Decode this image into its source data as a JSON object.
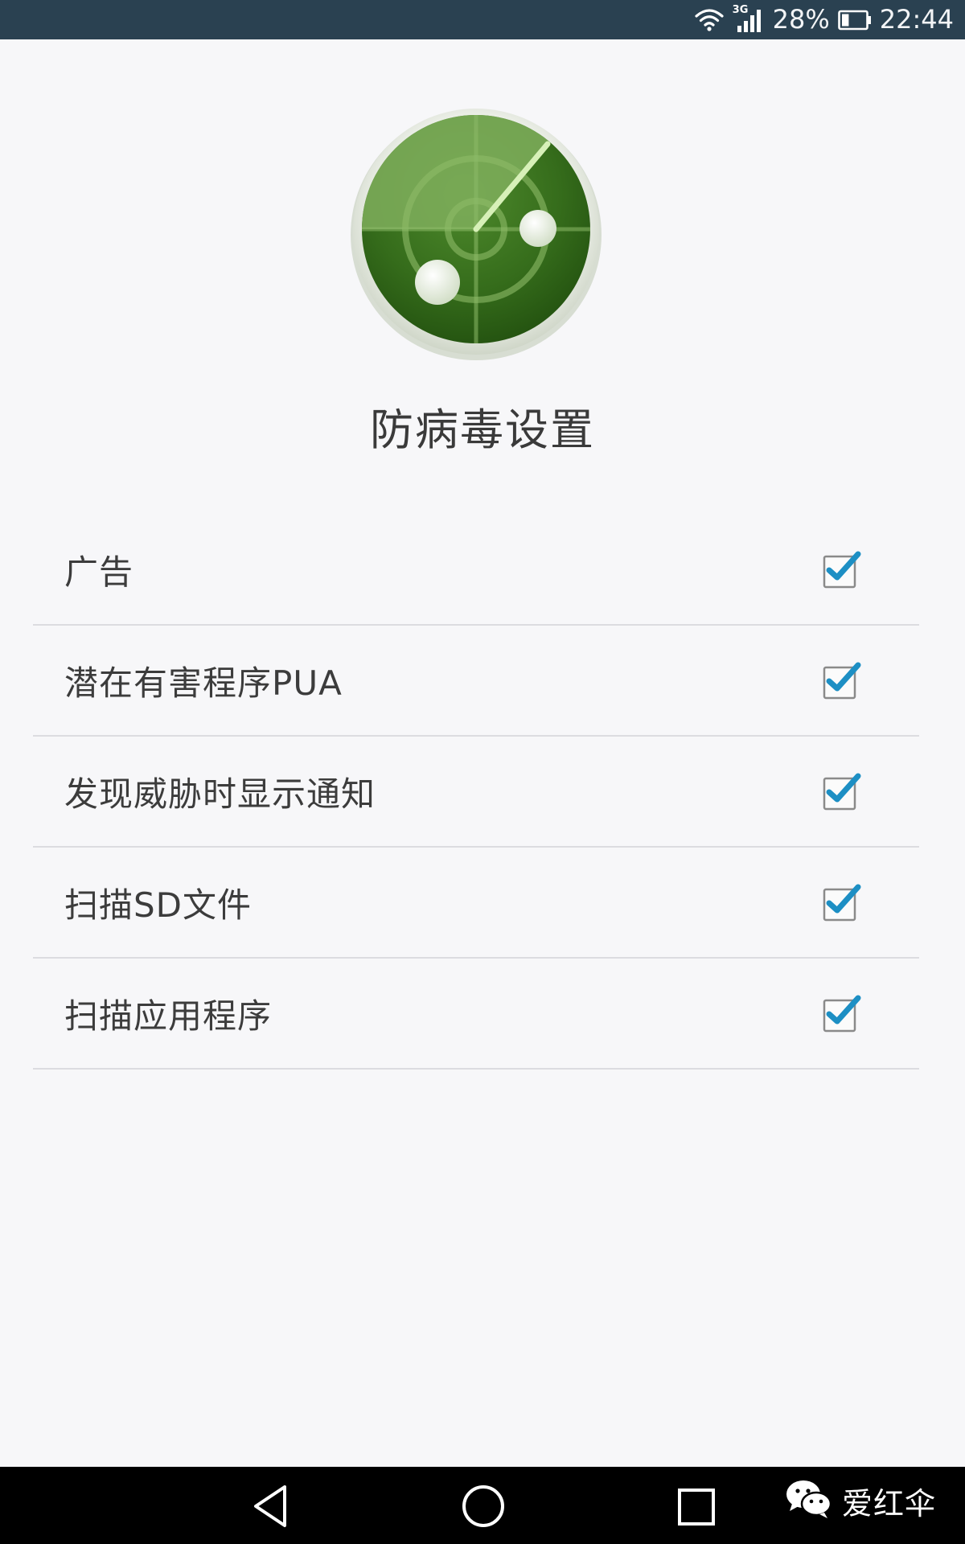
{
  "status_bar": {
    "network_label": "3G",
    "battery_percent": "28%",
    "battery_level": 0.28,
    "time": "22:44",
    "icons": [
      "wifi-icon",
      "signal-icon",
      "battery-icon"
    ],
    "background_color": "#2a4151"
  },
  "header": {
    "app_icon": "radar-scanner-icon",
    "title": "防病毒设置"
  },
  "settings": {
    "items": [
      {
        "label": "广告",
        "checked": true
      },
      {
        "label": "潜在有害程序PUA",
        "checked": true
      },
      {
        "label": "发现威胁时显示通知",
        "checked": true
      },
      {
        "label": "扫描SD文件",
        "checked": true
      },
      {
        "label": "扫描应用程序",
        "checked": true
      }
    ],
    "check_color": "#1d8fc4"
  },
  "nav_bar": {
    "buttons": [
      "back-icon",
      "home-icon",
      "recents-icon"
    ],
    "background_color": "#000000"
  },
  "watermark": {
    "icon": "wechat-icon",
    "text": "爱红伞"
  }
}
